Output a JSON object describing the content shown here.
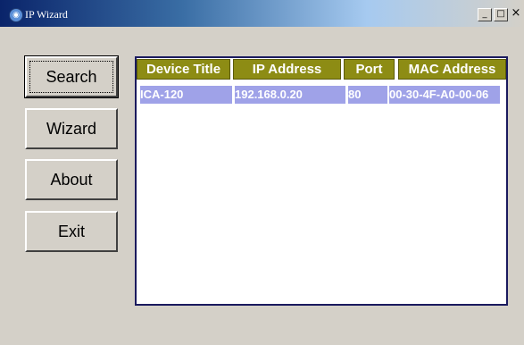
{
  "window": {
    "title": "IP Wizard",
    "icon": "globe-icon",
    "minimize_label": "_",
    "maximize_label": "□",
    "close_label": "×"
  },
  "sidebar": {
    "buttons": [
      {
        "label": "Search"
      },
      {
        "label": "Wizard"
      },
      {
        "label": "About"
      },
      {
        "label": "Exit"
      }
    ]
  },
  "table": {
    "columns": [
      "Device Title",
      "IP Address",
      "Port",
      "MAC Address"
    ],
    "rows": [
      {
        "device_title": "ICA-120",
        "ip_address": "192.168.0.20",
        "port": "80",
        "mac_address": "00-30-4F-A0-00-06"
      }
    ]
  },
  "colors": {
    "header_bg": "#8d8c14",
    "selection_bg": "#9fa2e8",
    "window_bg": "#d4d0c8"
  }
}
